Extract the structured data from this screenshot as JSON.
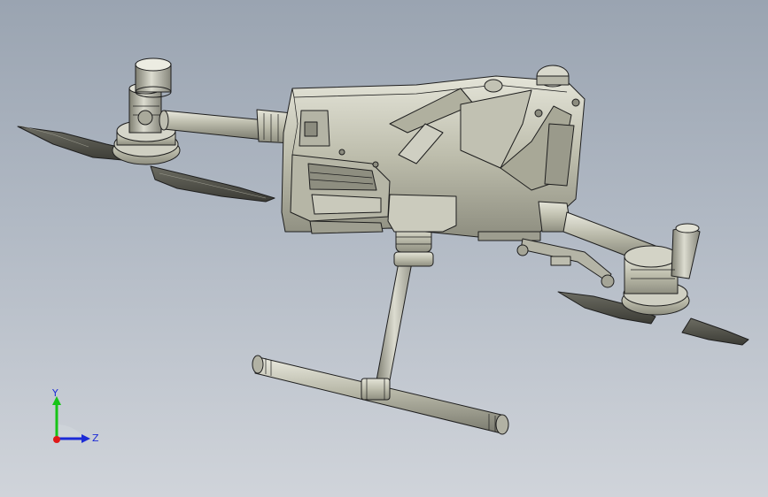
{
  "viewport": {
    "background_top": "#9aa4b1",
    "background_bottom": "#d0d4da",
    "model_color": "#c8c8b8",
    "edge_color": "#1e1e1e"
  },
  "triad": {
    "y_label": "Y",
    "z_label": "Z",
    "y_color": "#17c417",
    "z_color": "#1c2bd6",
    "origin_color": "#e01818"
  }
}
